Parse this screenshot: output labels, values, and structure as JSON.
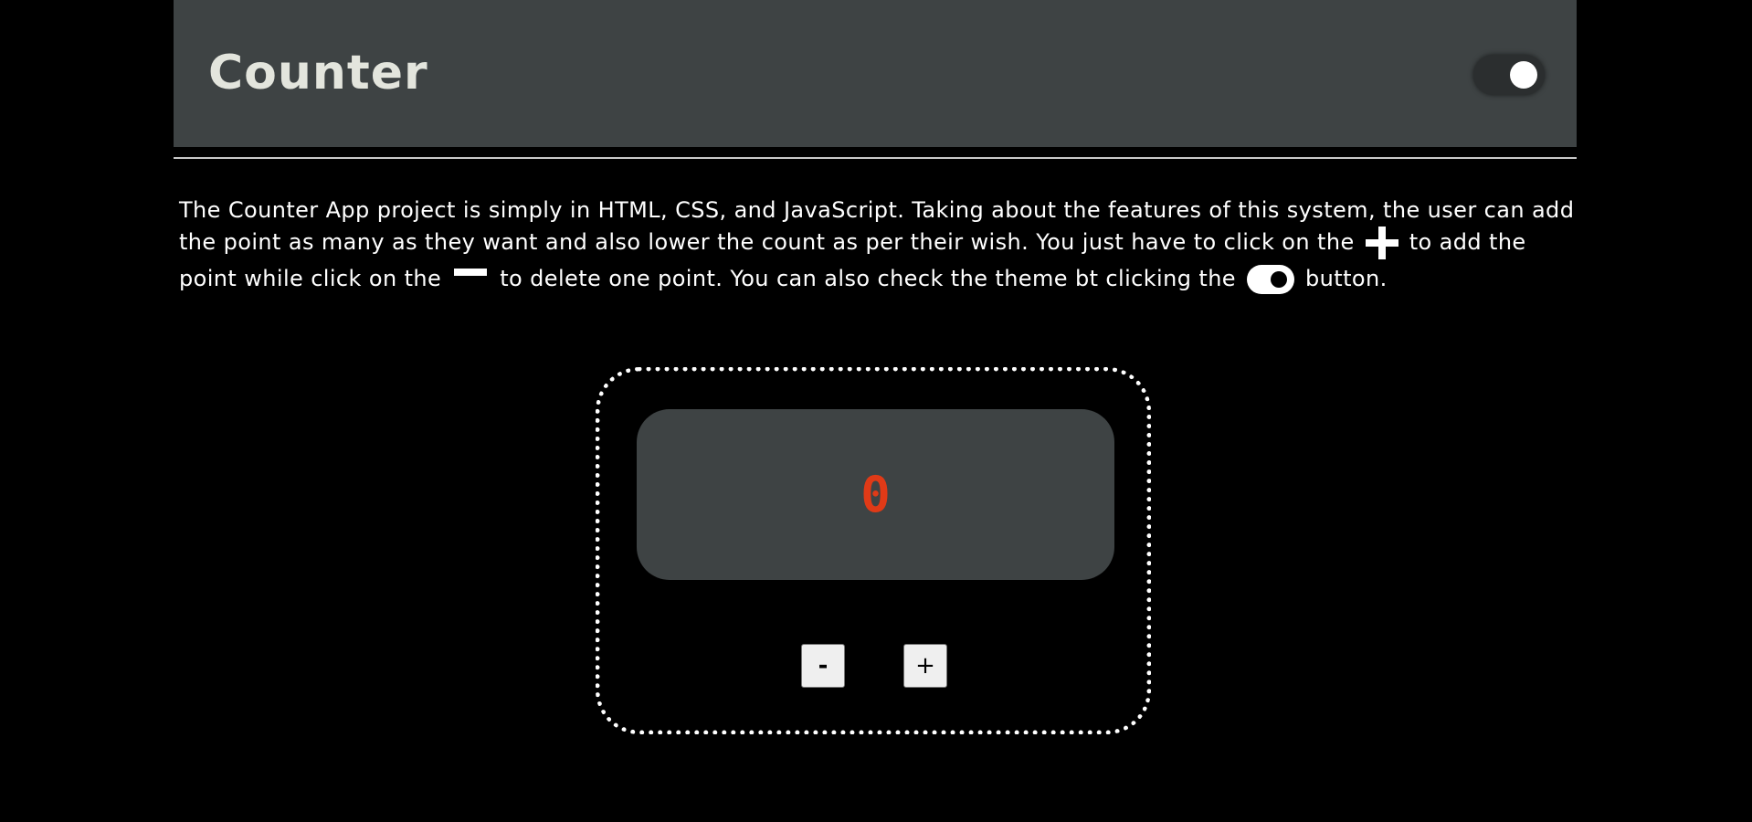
{
  "header": {
    "title": "Counter",
    "theme_toggle": {
      "state": "on",
      "icon": "toggle-icon"
    }
  },
  "description": {
    "part1": "The Counter App project is simply in HTML, CSS, and JavaScript. Taking about the features of this system, the user can add the point as many as they want and also lower the count as per their wish. You just have to click on the",
    "plus_icon": "plus-icon",
    "part2": "to add the point while click on the",
    "minus_icon": "minus-icon",
    "part3": "to delete one point. You can also check the theme bt clicking the",
    "toggle_icon": "toggle-icon",
    "part4": "button."
  },
  "counter": {
    "value": "0",
    "value_color": "#e03a17",
    "decrement_label": "-",
    "increment_label": "+"
  },
  "colors": {
    "background": "#000000",
    "panel": "#3e4344",
    "title": "#e3e5dd",
    "text": "#ffffff"
  }
}
